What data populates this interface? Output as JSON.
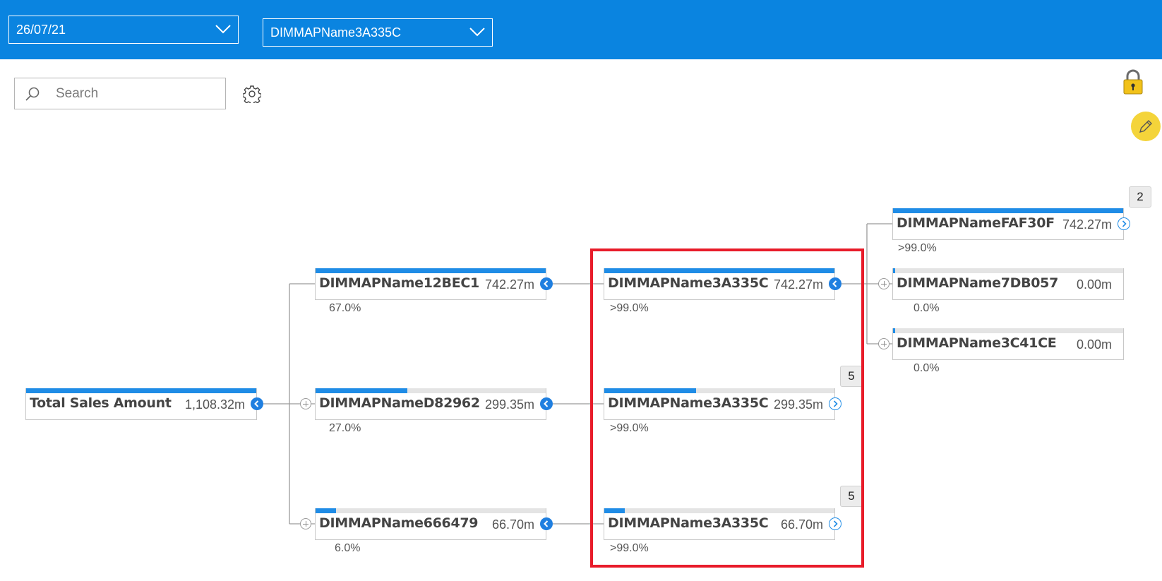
{
  "header": {
    "date_filter": "26/07/21",
    "name_filter": "DIMMAPName3A335C"
  },
  "search": {
    "placeholder": "Search"
  },
  "icons": {
    "search": "search-icon",
    "settings": "gear-icon",
    "lock": "lock-icon",
    "edit": "pencil-icon"
  },
  "colors": {
    "accent": "#0a84e0",
    "bar_fill": "#1f8ce6",
    "highlight": "#e81c2a",
    "edit_button": "#f4d43a"
  },
  "tree": {
    "root": {
      "label": "Total Sales Amount",
      "value": "1,108.32m",
      "fill": 1.0
    },
    "level1": [
      {
        "label": "DIMMAPName12BEC1",
        "value": "742.27m",
        "percent": "67.0%",
        "fill": 1.0
      },
      {
        "label": "DIMMAPNameD82962",
        "value": "299.35m",
        "percent": "27.0%",
        "fill": 0.4
      },
      {
        "label": "DIMMAPName666479",
        "value": "66.70m",
        "percent": "6.0%",
        "fill": 0.09
      }
    ],
    "level2": [
      {
        "label": "DIMMAPName3A335C",
        "value": "742.27m",
        "percent": ">99.0%",
        "fill": 1.0
      },
      {
        "label": "DIMMAPName3A335C",
        "value": "299.35m",
        "percent": ">99.0%",
        "fill": 0.4,
        "badge": "5"
      },
      {
        "label": "DIMMAPName3A335C",
        "value": "66.70m",
        "percent": ">99.0%",
        "fill": 0.09,
        "badge": "5"
      }
    ],
    "level3": [
      {
        "label": "DIMMAPNameFAF30F",
        "value": "742.27m",
        "percent": ">99.0%",
        "fill": 1.0,
        "badge": "2"
      },
      {
        "label": "DIMMAPName7DB057",
        "value": "0.00m",
        "percent": "0.0%",
        "fill": 0.01
      },
      {
        "label": "DIMMAPName3C41CE",
        "value": "0.00m",
        "percent": "0.0%",
        "fill": 0.01
      }
    ]
  }
}
